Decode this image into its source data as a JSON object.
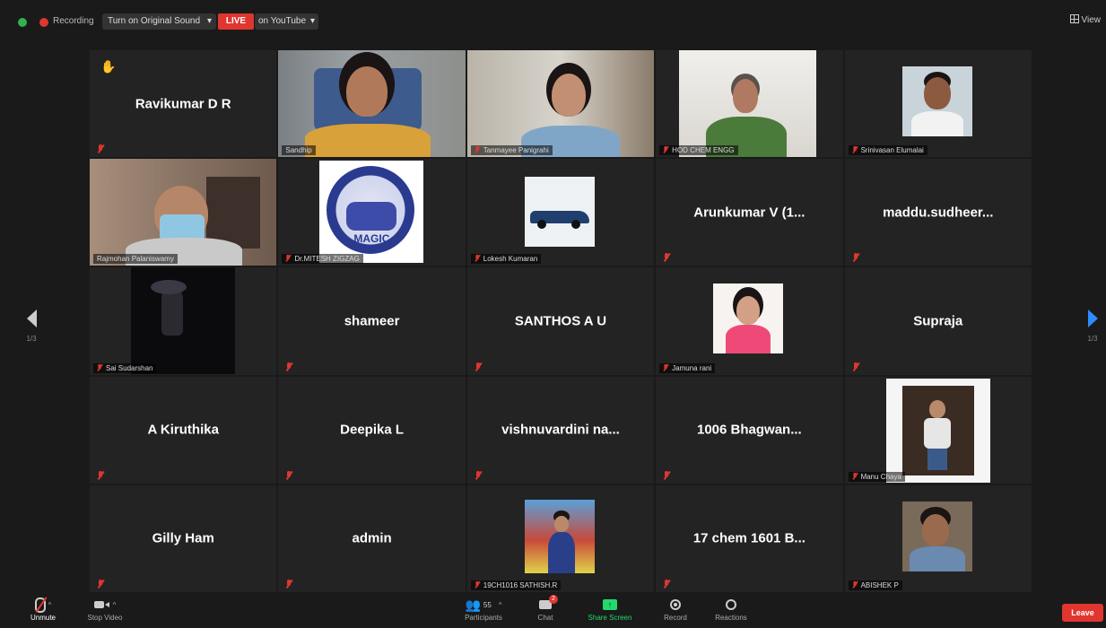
{
  "topbar": {
    "recording_label": "Recording",
    "sound_button": "Turn on Original Sound",
    "live_badge": "LIVE",
    "youtube_label": "on YouTube",
    "view_label": "View"
  },
  "nav": {
    "left_page": "1/3",
    "right_page": "1/3"
  },
  "tiles": [
    {
      "name": "Ravikumar D R",
      "kind": "name",
      "hand_raised": true
    },
    {
      "label": "Sandhip",
      "kind": "video"
    },
    {
      "label": "Tanmayee Panigrahi",
      "kind": "video"
    },
    {
      "label": "HOD CHEM ENGG",
      "kind": "video"
    },
    {
      "label": "Srinivasan Elumalai",
      "kind": "photo"
    },
    {
      "label": "Rajmohan Palaniswamy",
      "kind": "video",
      "active_speaker": true
    },
    {
      "label": "Dr.MITESH ZIGZAG",
      "kind": "logo",
      "logo_text": "MAGIC"
    },
    {
      "label": "Lokesh Kumaran",
      "kind": "photo"
    },
    {
      "name": "Arunkumar V (1...",
      "kind": "name"
    },
    {
      "name": "maddu.sudheer...",
      "kind": "name"
    },
    {
      "label": "Sai Sudarshan",
      "kind": "photo"
    },
    {
      "name": "shameer",
      "kind": "name"
    },
    {
      "name": "SANTHOS A U",
      "kind": "name"
    },
    {
      "label": "Jamuna rani",
      "kind": "photo"
    },
    {
      "name": "Supraja",
      "kind": "name"
    },
    {
      "name": "A Kiruthika",
      "kind": "name"
    },
    {
      "name": "Deepika L",
      "kind": "name"
    },
    {
      "name": "vishnuvardini na...",
      "kind": "name"
    },
    {
      "name": "1006 Bhagwan...",
      "kind": "name"
    },
    {
      "label": "Manu Chaya",
      "kind": "photo"
    },
    {
      "name": "Gilly Ham",
      "kind": "name"
    },
    {
      "name": "admin",
      "kind": "name"
    },
    {
      "label": "19CH1016 SATHISH.R",
      "kind": "photo"
    },
    {
      "name": "17 chem 1601 B...",
      "kind": "name"
    },
    {
      "label": "ABISHEK P",
      "kind": "photo"
    }
  ],
  "toolbar": {
    "unmute": "Unmute",
    "stop_video": "Stop Video",
    "participants": "Participants",
    "participants_count": "55",
    "chat": "Chat",
    "chat_badge": "2",
    "share_screen": "Share Screen",
    "record": "Record",
    "reactions": "Reactions",
    "leave": "Leave"
  },
  "colors": {
    "accent_green": "#23d96c",
    "live_red": "#e0362f",
    "active_border": "#b5d430",
    "nav_blue": "#2d8cff"
  }
}
